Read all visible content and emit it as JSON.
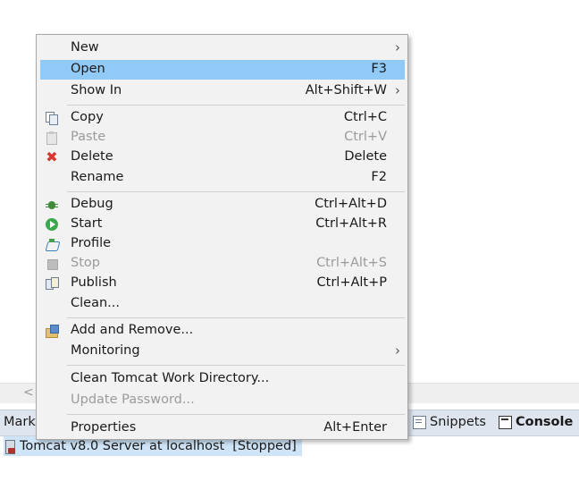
{
  "menu": {
    "items": [
      {
        "label": "New",
        "shortcut": "",
        "submenu": true,
        "icon": "",
        "disabled": false,
        "selected": false
      },
      {
        "label": "Open",
        "shortcut": "F3",
        "submenu": false,
        "icon": "",
        "disabled": false,
        "selected": true
      },
      {
        "label": "Show In",
        "shortcut": "Alt+Shift+W",
        "submenu": true,
        "icon": "",
        "disabled": false,
        "selected": false
      },
      {
        "label": "Copy",
        "shortcut": "Ctrl+C",
        "submenu": false,
        "icon": "copy-icon",
        "disabled": false,
        "selected": false
      },
      {
        "label": "Paste",
        "shortcut": "Ctrl+V",
        "submenu": false,
        "icon": "paste-icon",
        "disabled": true,
        "selected": false
      },
      {
        "label": "Delete",
        "shortcut": "Delete",
        "submenu": false,
        "icon": "delete-icon",
        "disabled": false,
        "selected": false
      },
      {
        "label": "Rename",
        "shortcut": "F2",
        "submenu": false,
        "icon": "",
        "disabled": false,
        "selected": false
      },
      {
        "label": "Debug",
        "shortcut": "Ctrl+Alt+D",
        "submenu": false,
        "icon": "debug-icon",
        "disabled": false,
        "selected": false
      },
      {
        "label": "Start",
        "shortcut": "Ctrl+Alt+R",
        "submenu": false,
        "icon": "start-icon",
        "disabled": false,
        "selected": false
      },
      {
        "label": "Profile",
        "shortcut": "",
        "submenu": false,
        "icon": "profile-icon",
        "disabled": false,
        "selected": false
      },
      {
        "label": "Stop",
        "shortcut": "Ctrl+Alt+S",
        "submenu": false,
        "icon": "stop-icon",
        "disabled": true,
        "selected": false
      },
      {
        "label": "Publish",
        "shortcut": "Ctrl+Alt+P",
        "submenu": false,
        "icon": "publish-icon",
        "disabled": false,
        "selected": false
      },
      {
        "label": "Clean...",
        "shortcut": "",
        "submenu": false,
        "icon": "",
        "disabled": false,
        "selected": false
      },
      {
        "label": "Add and Remove...",
        "shortcut": "",
        "submenu": false,
        "icon": "add-remove-icon",
        "disabled": false,
        "selected": false
      },
      {
        "label": "Monitoring",
        "shortcut": "",
        "submenu": true,
        "icon": "",
        "disabled": false,
        "selected": false
      },
      {
        "label": "Clean Tomcat Work Directory...",
        "shortcut": "",
        "submenu": false,
        "icon": "",
        "disabled": false,
        "selected": false
      },
      {
        "label": "Update Password...",
        "shortcut": "",
        "submenu": false,
        "icon": "",
        "disabled": true,
        "selected": false
      },
      {
        "label": "Properties",
        "shortcut": "Alt+Enter",
        "submenu": false,
        "icon": "",
        "disabled": false,
        "selected": false
      }
    ],
    "arrow_glyph": "›"
  },
  "background": {
    "scroll_left_glyph": "<",
    "tabs": {
      "markers_partial": "Mark",
      "snippets": "Snippets",
      "console": "Console"
    },
    "server_row": {
      "label": "Tomcat v8.0 Server at localhost",
      "status": "[Stopped]"
    }
  },
  "colors": {
    "menu_bg": "#f2f2f2",
    "selection": "#91c9f7",
    "disabled_text": "#9b9b9b",
    "server_row_bg": "#cfe4f7"
  }
}
